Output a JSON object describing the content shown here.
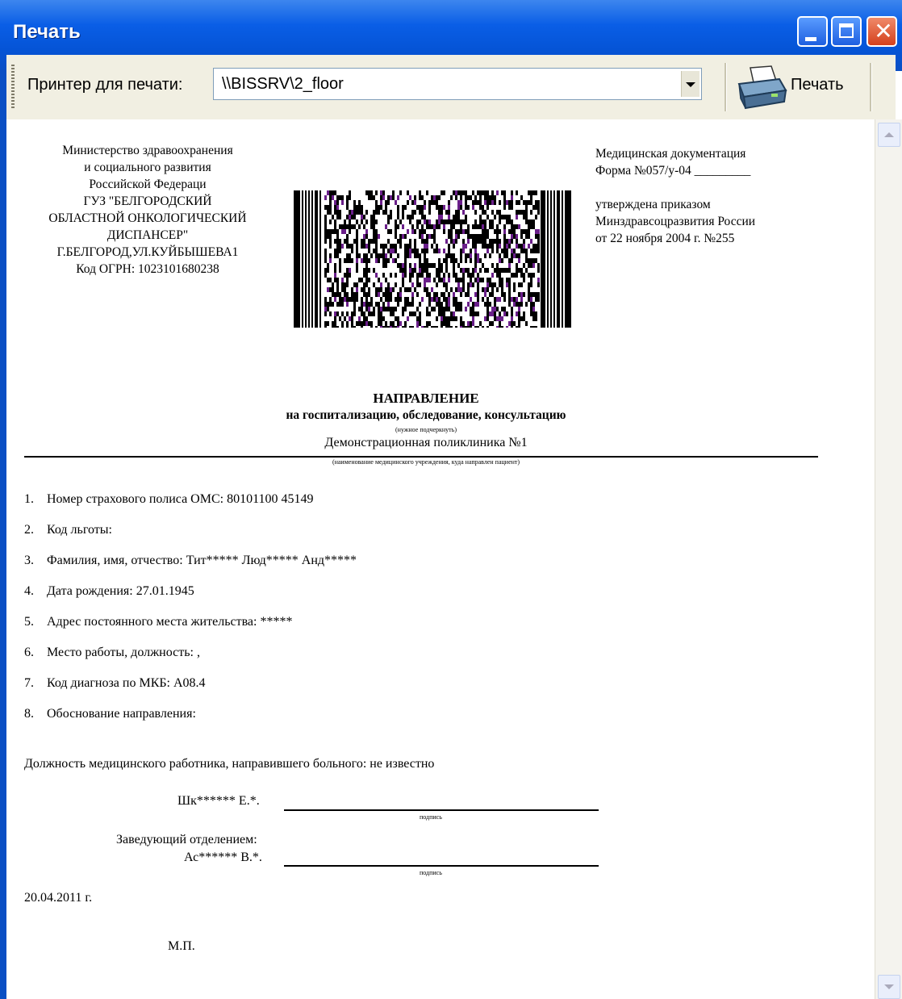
{
  "window": {
    "title": "Печать"
  },
  "toolbar": {
    "printer_label": "Принтер для печати:",
    "printer_value": "\\\\BISSRV\\2_floor",
    "print_label": "Печать"
  },
  "document": {
    "org_lines": [
      "Министерство здравоохранения",
      "и социального развития",
      "Российской Федераци",
      "ГУЗ \"БЕЛГОРОДСКИЙ",
      "ОБЛАСТНОЙ ОНКОЛОГИЧЕСКИЙ",
      "ДИСПАНСЕР\"",
      "Г.БЕЛГОРОД,УЛ.КУЙБЫШЕВА1",
      "Код ОГРН: 1023101680238"
    ],
    "meta_lines": [
      "Медицинская документация",
      "Форма №057/у-04 _________",
      "",
      "утверждена приказом",
      "Минздравсоцразвития России",
      "от 22 ноября 2004 г. №255"
    ],
    "title": "НАПРАВЛЕНИЕ",
    "subtitle": "на госпитализацию, обследование, консультацию",
    "subtitle_note": "(нужное подчеркнуть)",
    "clinic": "Демонстрационная поликлиника №1",
    "clinic_note": "(наименование медицинского учреждения, куда направлен пациент)",
    "items": [
      {
        "num": "1.",
        "text": "Номер страхового полиса ОМС: 80101100 45149"
      },
      {
        "num": "2.",
        "text": "Код льготы:"
      },
      {
        "num": "3.",
        "text": "Фамилия, имя, отчество: Тит***** Люд***** Анд*****"
      },
      {
        "num": "4.",
        "text": "Дата рождения: 27.01.1945"
      },
      {
        "num": "5.",
        "text": "Адрес постоянного места жительства: *****"
      },
      {
        "num": "6.",
        "text": "Место работы, должность: ,"
      },
      {
        "num": "7.",
        "text": "Код диагноза по МКБ: A08.4"
      },
      {
        "num": "8.",
        "text": "Обоснование направления:"
      }
    ],
    "position_line": "Должность медицинского работника, направившего больного: не известно",
    "signer1": "Шк****** Е.*.",
    "signature_caption": "подпись",
    "head_label": "Заведующий отделением:",
    "signer2": "Ас****** В.*.",
    "date": "20.04.2011 г.",
    "stamp": "М.П."
  },
  "colors": {
    "titlebar": "#0554d6",
    "close_button": "#d4401c"
  }
}
